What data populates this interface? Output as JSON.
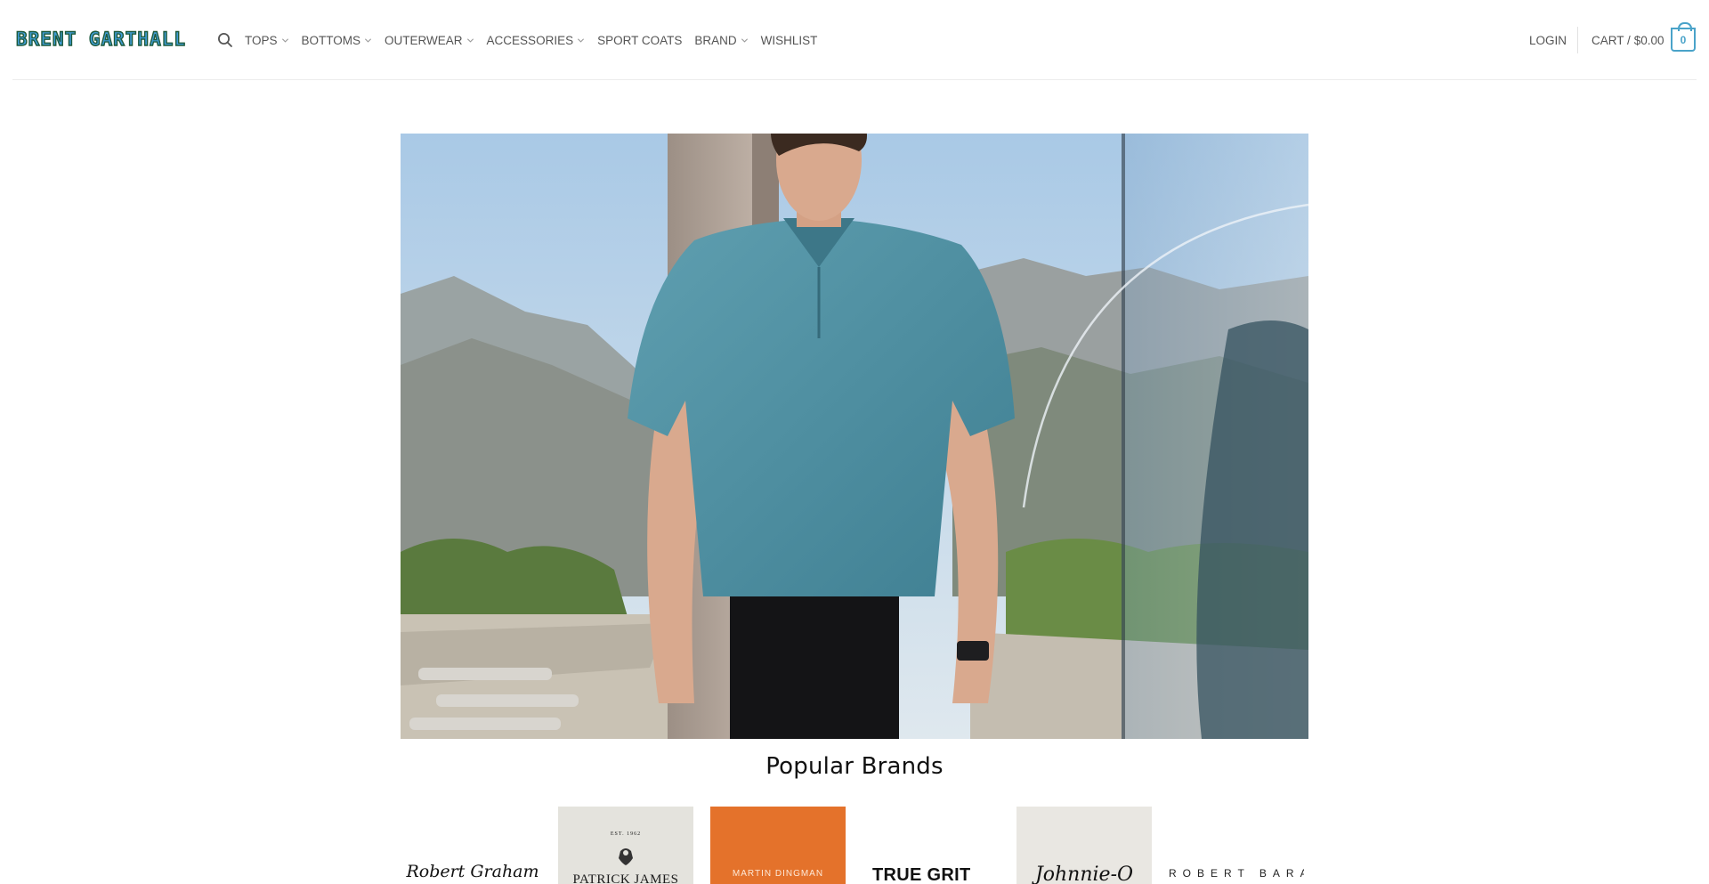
{
  "header": {
    "logo_text": "Brent Garthall",
    "nav": [
      {
        "label": "TOPS",
        "dropdown": true
      },
      {
        "label": "BOTTOMS",
        "dropdown": true
      },
      {
        "label": "OUTERWEAR",
        "dropdown": true
      },
      {
        "label": "ACCESSORIES",
        "dropdown": true
      },
      {
        "label": "SPORT COATS",
        "dropdown": false
      },
      {
        "label": "BRAND",
        "dropdown": true
      },
      {
        "label": "WISHLIST",
        "dropdown": false
      }
    ],
    "login_label": "LOGIN",
    "cart_label": "CART /",
    "cart_total": "$0.00",
    "cart_count": "0",
    "icons": {
      "search": "search-icon",
      "chevron": "chevron-down-icon",
      "cart": "shopping-bag-icon"
    },
    "colors": {
      "accent": "#4aa3c9",
      "logo_fill": "#3f9cd6",
      "logo_outline": "#1d5a3c"
    }
  },
  "hero": {
    "image": "man-in-teal-polo-walking-outdoors"
  },
  "brands_section": {
    "title": "Popular Brands",
    "brands": [
      {
        "label": "Robert Graham"
      },
      {
        "label": "PATRICK JAMES",
        "badge": "EST. 1962"
      },
      {
        "label": "MARTIN DINGMAN"
      },
      {
        "label": "TRUE GRIT"
      },
      {
        "label": "Johnnie-O"
      },
      {
        "label": "ROBERT BARAKETT"
      }
    ]
  }
}
